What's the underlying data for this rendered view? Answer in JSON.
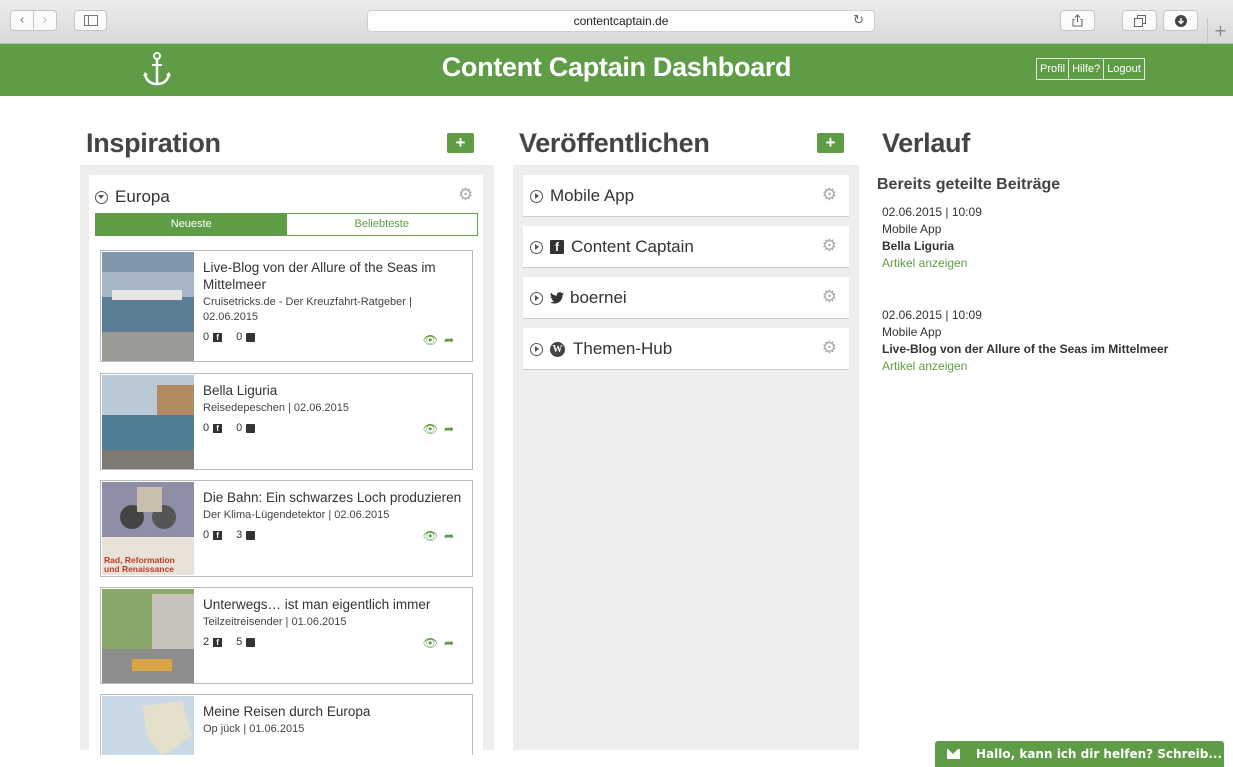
{
  "browser": {
    "url": "contentcaptain.de"
  },
  "header": {
    "title": "Content Captain Dashboard",
    "links": [
      "Profil",
      "Hilfe?",
      "Logout"
    ]
  },
  "inspiration": {
    "title": "Inspiration",
    "add_label": "+",
    "feed": {
      "name": "Europa",
      "tabs": [
        "Neueste",
        "Beliebteste"
      ],
      "articles": [
        {
          "title": "Live-Blog von der Allure of the Seas im Mittelmeer",
          "source": "Cruisetricks.de - Der Kreuzfahrt-Ratgeber | 02.06.2015",
          "facebook": "0",
          "twitter": "0"
        },
        {
          "title": "Bella Liguria",
          "source": "Reisedepeschen | 02.06.2015",
          "facebook": "0",
          "twitter": "0"
        },
        {
          "title": "Die Bahn: Ein schwarzes Loch produzieren",
          "source": "Der Klima-Lügendetektor | 02.06.2015",
          "facebook": "0",
          "twitter": "3",
          "thumb_caption": "Rad, Reformation und Renaissance"
        },
        {
          "title": "Unterwegs… ist man eigentlich immer",
          "source": "Teilzeitreisender | 01.06.2015",
          "facebook": "2",
          "twitter": "5"
        },
        {
          "title": "Meine Reisen durch Europa",
          "source": "Op jück | 01.06.2015"
        }
      ]
    }
  },
  "publish": {
    "title": "Veröffentlichen",
    "add_label": "+",
    "channels": [
      {
        "label": "Mobile App",
        "icon": "none"
      },
      {
        "label": "Content Captain",
        "icon": "facebook-icon"
      },
      {
        "label": "boernei",
        "icon": "twitter-icon"
      },
      {
        "label": "Themen-Hub",
        "icon": "wordpress-icon"
      }
    ]
  },
  "history": {
    "title": "Verlauf",
    "subtitle": "Bereits geteilte Beiträge",
    "entries": [
      {
        "datetime": "02.06.2015 | 10:09",
        "channel": "Mobile App",
        "article": "Bella Liguria",
        "link": "Artikel anzeigen"
      },
      {
        "datetime": "02.06.2015 | 10:09",
        "channel": "Mobile App",
        "article": "Live-Blog von der Allure of the Seas im Mittelmeer",
        "link": "Artikel anzeigen"
      }
    ]
  },
  "chat": {
    "label": "Hallo, kann ich dir helfen? Schreib..."
  },
  "colors": {
    "brand": "#5f9c46",
    "panel": "#eeeeee"
  }
}
